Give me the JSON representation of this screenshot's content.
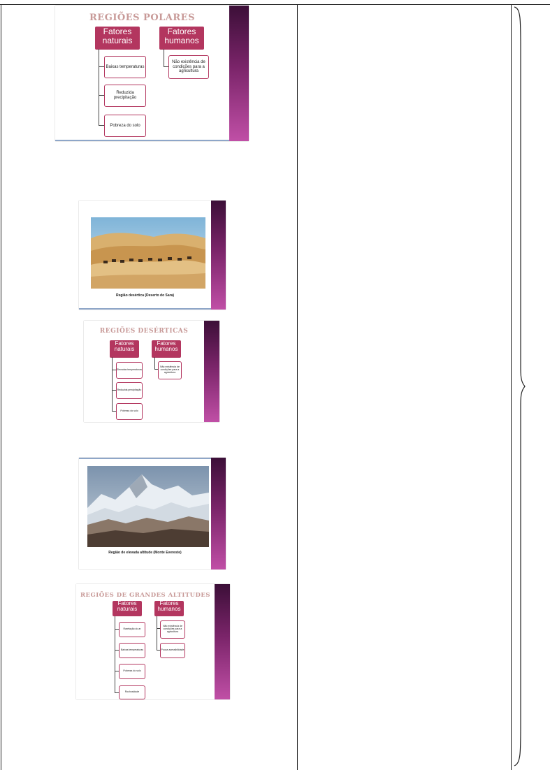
{
  "slide1": {
    "title": "REGIÕES POLARES",
    "col_natural": "Fatores naturais",
    "col_human": "Fatores humanos",
    "natural": [
      "Baixas temperaturas",
      "Reduzida precipitação",
      "Pobreza do solo"
    ],
    "human": [
      "Não existência de condições para a agricultura"
    ]
  },
  "slide2": {
    "caption": "Região desértica (Deserto do Sara)"
  },
  "slide3": {
    "title": "REGIÕES DESÉRTICAS",
    "col_natural": "Fatores naturais",
    "col_human": "Fatores humanos",
    "natural": [
      "Elevadas temperaturas",
      "Reduzida precipitação",
      "Pobreza do solo"
    ],
    "human": [
      "Não existência de condições para a agricultura"
    ]
  },
  "slide4": {
    "caption": "Região de elevada altitude (Monte Evereste)"
  },
  "slide5": {
    "title": "REGIÕES DE GRANDES ALTITUDES",
    "col_natural": "Fatores naturais",
    "col_human": "Fatores humanos",
    "natural": [
      "Rarefação do ar",
      "Baixas temperaturas",
      "Pobreza do solo",
      "Rochosidade"
    ],
    "human": [
      "Não existência de condições para a agricultura",
      "Pouca acessibilidade"
    ]
  },
  "colors": {
    "accent": "#b3365f",
    "bar": "#7a2469",
    "title": "#c89a98"
  }
}
